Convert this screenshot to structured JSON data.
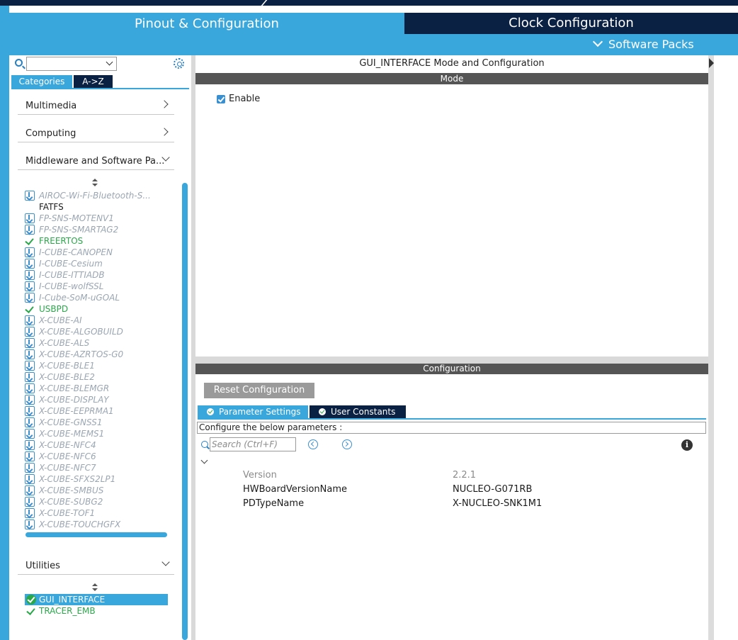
{
  "header": {
    "tab_pinout": "Pinout & Configuration",
    "tab_clock": "Clock Configuration",
    "software_packs": "Software Packs"
  },
  "sidebar": {
    "search_select_value": "",
    "tab_categories": "Categories",
    "tab_az": "A->Z",
    "categories": {
      "multimedia": "Multimedia",
      "computing": "Computing",
      "middleware": "Middleware and Software Pa...",
      "utilities": "Utilities"
    },
    "middleware_items": [
      {
        "label": "AIROC-Wi-Fi-Bluetooth-S...",
        "state": "download"
      },
      {
        "label": "FATFS",
        "state": "plain"
      },
      {
        "label": "FP-SNS-MOTENV1",
        "state": "download"
      },
      {
        "label": "FP-SNS-SMARTAG2",
        "state": "download"
      },
      {
        "label": "FREERTOS",
        "state": "enabled"
      },
      {
        "label": "I-CUBE-CANOPEN",
        "state": "download"
      },
      {
        "label": "I-CUBE-Cesium",
        "state": "download"
      },
      {
        "label": "I-CUBE-ITTIADB",
        "state": "download"
      },
      {
        "label": "I-CUBE-wolfSSL",
        "state": "download"
      },
      {
        "label": "I-Cube-SoM-uGOAL",
        "state": "download"
      },
      {
        "label": "USBPD",
        "state": "enabled"
      },
      {
        "label": "X-CUBE-AI",
        "state": "download"
      },
      {
        "label": "X-CUBE-ALGOBUILD",
        "state": "download"
      },
      {
        "label": "X-CUBE-ALS",
        "state": "download"
      },
      {
        "label": "X-CUBE-AZRTOS-G0",
        "state": "download"
      },
      {
        "label": "X-CUBE-BLE1",
        "state": "download"
      },
      {
        "label": "X-CUBE-BLE2",
        "state": "download"
      },
      {
        "label": "X-CUBE-BLEMGR",
        "state": "download"
      },
      {
        "label": "X-CUBE-DISPLAY",
        "state": "download"
      },
      {
        "label": "X-CUBE-EEPRMA1",
        "state": "download"
      },
      {
        "label": "X-CUBE-GNSS1",
        "state": "download"
      },
      {
        "label": "X-CUBE-MEMS1",
        "state": "download"
      },
      {
        "label": "X-CUBE-NFC4",
        "state": "download"
      },
      {
        "label": "X-CUBE-NFC6",
        "state": "download"
      },
      {
        "label": "X-CUBE-NFC7",
        "state": "download"
      },
      {
        "label": "X-CUBE-SFXS2LP1",
        "state": "download"
      },
      {
        "label": "X-CUBE-SMBUS",
        "state": "download"
      },
      {
        "label": "X-CUBE-SUBG2",
        "state": "download"
      },
      {
        "label": "X-CUBE-TOF1",
        "state": "download"
      },
      {
        "label": "X-CUBE-TOUCHGFX",
        "state": "download"
      }
    ],
    "utility_items": [
      {
        "label": "GUI_INTERFACE",
        "state": "selected"
      },
      {
        "label": "TRACER_EMB",
        "state": "enabled"
      }
    ]
  },
  "main": {
    "title": "GUI_INTERFACE Mode and Configuration",
    "mode_header": "Mode",
    "enable_label": "Enable",
    "enable_checked": true,
    "config_header": "Configuration",
    "reset_button": "Reset Configuration",
    "tab_parameter_settings": "Parameter Settings",
    "tab_user_constants": "User Constants",
    "configure_label": "Configure the below parameters :",
    "search_placeholder": "Search (Ctrl+F)",
    "info_glyph": "i",
    "parameters": [
      {
        "name": "Version",
        "value": "2.2.1",
        "muted": true
      },
      {
        "name": "HWBoardVersionName",
        "value": "NUCLEO-G071RB",
        "muted": false
      },
      {
        "name": "PDTypeName",
        "value": "X-NUCLEO-SNK1M1",
        "muted": false
      }
    ]
  },
  "colors": {
    "accent_blue": "#3aa7dc",
    "navy": "#0b2144",
    "section_gray": "#555555",
    "enabled_green": "#2aa84a",
    "download_gray": "#9aa6b2"
  }
}
